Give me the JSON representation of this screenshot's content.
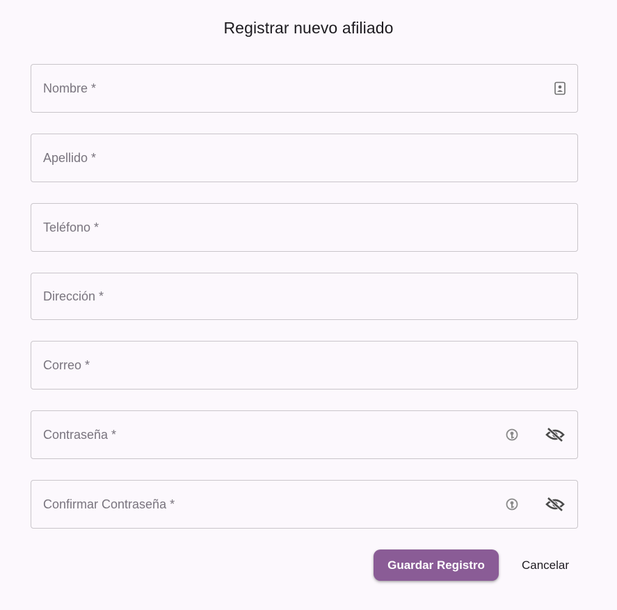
{
  "dialog": {
    "title": "Registrar nuevo afiliado"
  },
  "form": {
    "fields": [
      {
        "placeholder": "Nombre *",
        "value": "",
        "icon": "contact-card-icon"
      },
      {
        "placeholder": "Apellido *",
        "value": ""
      },
      {
        "placeholder": "Teléfono *",
        "value": ""
      },
      {
        "placeholder": "Dirección *",
        "value": ""
      },
      {
        "placeholder": "Correo *",
        "value": ""
      },
      {
        "placeholder": "Contraseña *",
        "value": "",
        "icons": [
          "password-key-icon",
          "eye-off-icon"
        ]
      },
      {
        "placeholder": "Confirmar Contraseña *",
        "value": "",
        "icons": [
          "password-key-icon",
          "eye-off-icon"
        ]
      }
    ]
  },
  "actions": {
    "save_label": "Guardar Registro",
    "cancel_label": "Cancelar"
  },
  "colors": {
    "primary": "#8a5c96",
    "background": "#fcf8fd",
    "outline": "#c9c5ca",
    "placeholder": "#79747e",
    "icon": "#5f5f5f"
  }
}
